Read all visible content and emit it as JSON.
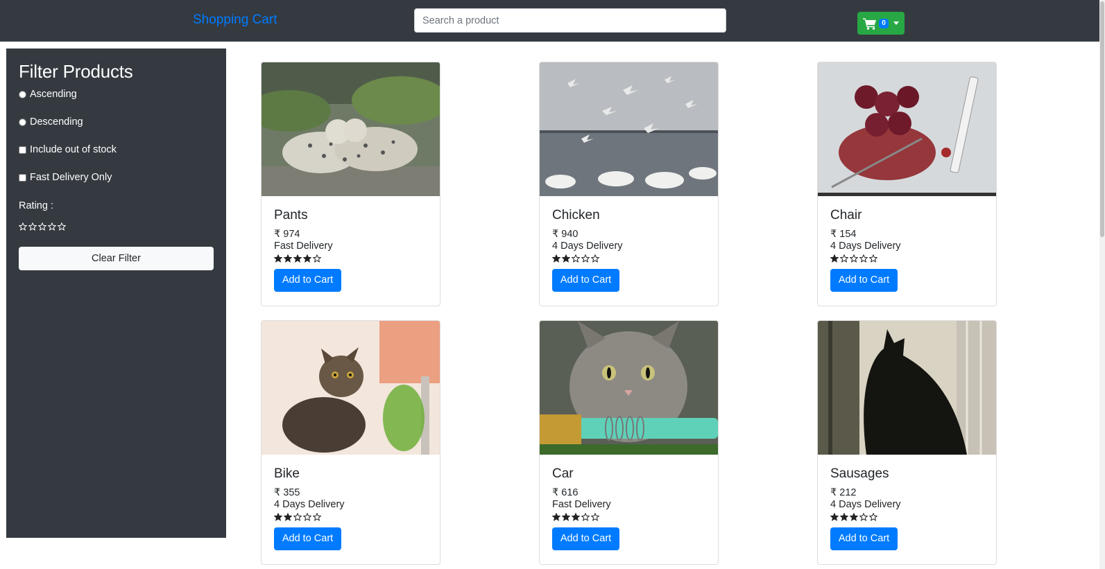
{
  "header": {
    "brand": "Shopping Cart",
    "search_placeholder": "Search a product",
    "cart_count": "0"
  },
  "sidebar": {
    "title": "Filter Products",
    "ascending": "Ascending",
    "descending": "Descending",
    "include_out_of_stock": "Include out of stock",
    "fast_delivery_only": "Fast Delivery Only",
    "rating_label": "Rating :",
    "rating_value": 0,
    "clear_filter": "Clear Filter"
  },
  "products": [
    {
      "name": "Pants",
      "price": "₹ 974",
      "delivery": "Fast Delivery",
      "rating": 4,
      "button": "Add to Cart",
      "image": "snow-leopards"
    },
    {
      "name": "Chicken",
      "price": "₹ 940",
      "delivery": "4 Days Delivery",
      "rating": 2,
      "button": "Add to Cart",
      "image": "seagulls-and-swans"
    },
    {
      "name": "Chair",
      "price": "₹ 154",
      "delivery": "4 Days Delivery",
      "rating": 1,
      "button": "Add to Cart",
      "image": "bloody-tray-syringe"
    },
    {
      "name": "Bike",
      "price": "₹ 355",
      "delivery": "4 Days Delivery",
      "rating": 2,
      "button": "Add to Cart",
      "image": "tabby-cat"
    },
    {
      "name": "Car",
      "price": "₹ 616",
      "delivery": "Fast Delivery",
      "rating": 3,
      "button": "Add to Cart",
      "image": "kitten-with-hose"
    },
    {
      "name": "Sausages",
      "price": "₹ 212",
      "delivery": "4 Days Delivery",
      "rating": 3,
      "button": "Add to Cart",
      "image": "black-cat-window"
    }
  ],
  "colors": {
    "navbar": "#343a40",
    "brand": "#007bff",
    "cart_button": "#28a745",
    "primary_button": "#007bff"
  }
}
